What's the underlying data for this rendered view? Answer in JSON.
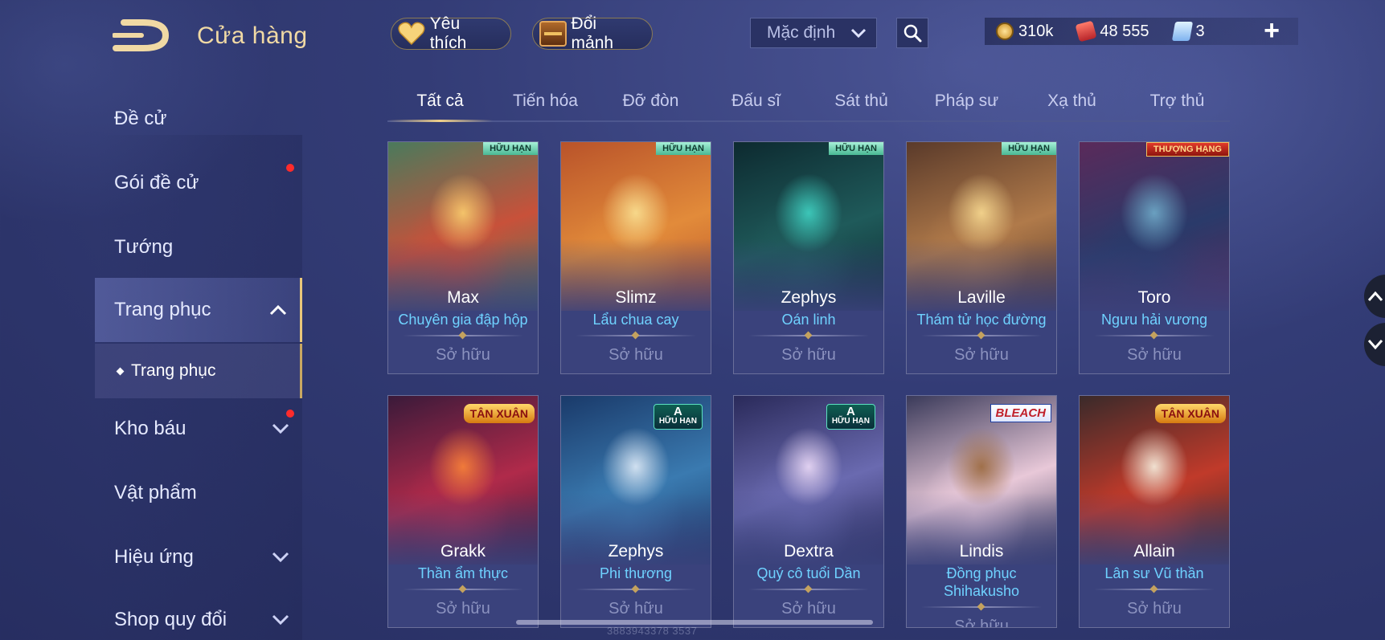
{
  "header": {
    "title": "Cửa hàng",
    "favorites_label": "Yêu thích",
    "fragments_label": "Đổi mảnh",
    "sort_value": "Mặc định"
  },
  "currency": {
    "gold": "310k",
    "vouchers": "48 555",
    "gems": "3"
  },
  "sidebar": {
    "items": [
      {
        "label": "Đề cử"
      },
      {
        "label": "Gói đề cử"
      },
      {
        "label": "Tướng"
      },
      {
        "label": "Trang phục"
      },
      {
        "label": "Kho báu"
      },
      {
        "label": "Vật phẩm"
      },
      {
        "label": "Hiệu ứng"
      },
      {
        "label": "Shop quy đổi"
      }
    ],
    "sub_item": "Trang phục"
  },
  "tabs": [
    "Tất cả",
    "Tiến hóa",
    "Đỡ đòn",
    "Đấu sĩ",
    "Sát thủ",
    "Pháp sư",
    "Xạ thủ",
    "Trợ thủ"
  ],
  "cards": [
    {
      "hero": "Max",
      "skin": "Chuyên gia đập hộp",
      "status": "Sở hữu",
      "badge": "HỮU HẠN",
      "colors": [
        "#c8513a",
        "#f3c36a",
        "#4a7a5c"
      ]
    },
    {
      "hero": "Slimz",
      "skin": "Lẩu chua cay",
      "status": "Sở hữu",
      "badge": "HỮU HẠN",
      "colors": [
        "#e28b3a",
        "#f7d88a",
        "#b9532a"
      ]
    },
    {
      "hero": "Zephys",
      "skin": "Oán linh",
      "status": "Sở hữu",
      "badge": "HỮU HẠN",
      "colors": [
        "#1f5a5a",
        "#3cc6b8",
        "#0d2a30"
      ]
    },
    {
      "hero": "Laville",
      "skin": "Thám tử học đường",
      "status": "Sở hữu",
      "badge": "HỮU HẠN",
      "colors": [
        "#b07a4a",
        "#f0d08a",
        "#5a3a2a"
      ]
    },
    {
      "hero": "Toro",
      "skin": "Ngưu hải vương",
      "status": "Sở hữu",
      "badge": "THƯỢNG HẠNG",
      "colors": [
        "#2a3a6a",
        "#6aa0c0",
        "#5a2a5a"
      ]
    },
    {
      "hero": "Grakk",
      "skin": "Thần ẩm thực",
      "status": "Sở hữu",
      "badge": "TÂN XUÂN",
      "colors": [
        "#b02a4a",
        "#f07a3a",
        "#3a1a3a"
      ]
    },
    {
      "hero": "Zephys",
      "skin": "Phi thương",
      "status": "Sở hữu",
      "badge": "HỮU HẠN",
      "tier": "A",
      "colors": [
        "#3a7ab0",
        "#d0e0f0",
        "#1a3a6a"
      ]
    },
    {
      "hero": "Dextra",
      "skin": "Quý cô tuổi Dần",
      "status": "Sở hữu",
      "badge": "HỮU HẠN",
      "tier": "A",
      "colors": [
        "#6a6ab0",
        "#e0d0f0",
        "#2a2a5a"
      ]
    },
    {
      "hero": "Lindis",
      "skin": "Đồng phục Shihakusho",
      "status": "Sở hữu",
      "badge": "BLEACH",
      "colors": [
        "#e8c8d8",
        "#a0704a",
        "#3a3a5a"
      ]
    },
    {
      "hero": "Allain",
      "skin": "Lân sư Vũ thần",
      "status": "Sở hữu",
      "badge": "TÂN XUÂN",
      "colors": [
        "#c03a2a",
        "#f0e0d0",
        "#3a2a2a"
      ]
    }
  ],
  "watermark": "3883943378 3537",
  "colors": {
    "accent_gold": "#f0d9a4",
    "skin_name_blue": "#6fd2ff",
    "notification_red": "#ff2b2b"
  }
}
